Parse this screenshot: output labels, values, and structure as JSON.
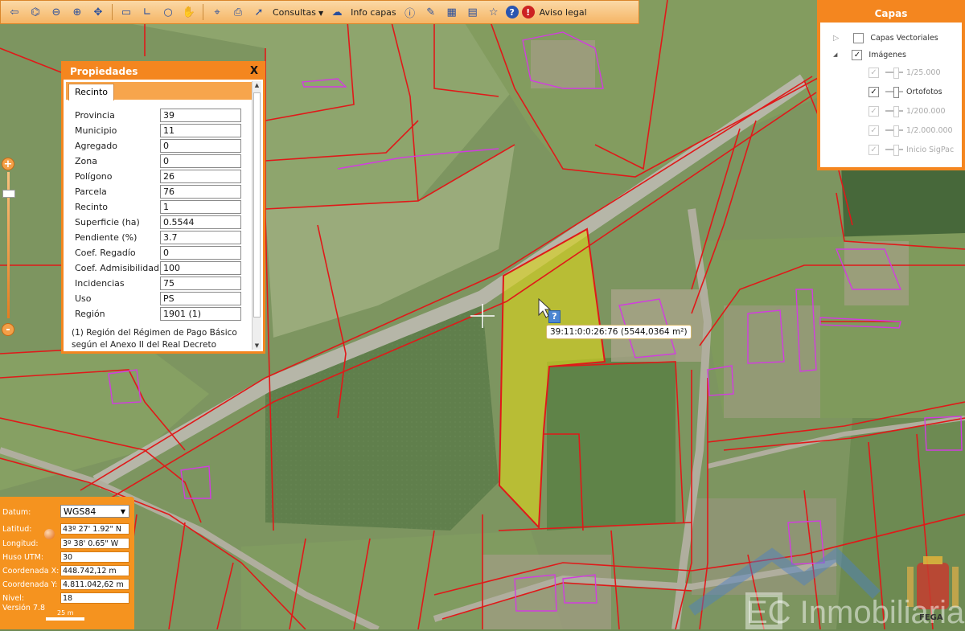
{
  "toolbar": {
    "consultas_label": "Consultas",
    "info_capas_label": "Info capas",
    "aviso_legal_label": "Aviso legal"
  },
  "properties": {
    "title": "Propiedades",
    "close_label": "X",
    "tab_label": "Recinto",
    "rows": [
      {
        "label": "Provincia",
        "value": "39"
      },
      {
        "label": "Municipio",
        "value": "11"
      },
      {
        "label": "Agregado",
        "value": "0"
      },
      {
        "label": "Zona",
        "value": "0"
      },
      {
        "label": "Polígono",
        "value": "26"
      },
      {
        "label": "Parcela",
        "value": "76"
      },
      {
        "label": "Recinto",
        "value": "1"
      },
      {
        "label": "Superficie (ha)",
        "value": "0.5544"
      },
      {
        "label": "Pendiente (%)",
        "value": "3.7"
      },
      {
        "label": "Coef. Regadío",
        "value": "0"
      },
      {
        "label": "Coef. Admisibilidad",
        "value": "100"
      },
      {
        "label": "Incidencias",
        "value": "75"
      },
      {
        "label": "Uso",
        "value": "PS"
      },
      {
        "label": "Región",
        "value": "1901 (1)"
      }
    ],
    "note": "(1) Región del Régimen de Pago Básico según el Anexo II del Real Decreto"
  },
  "layers": {
    "title": "Capas",
    "items": [
      {
        "label": "Capas Vectoriales",
        "checked": false,
        "enabled": true
      },
      {
        "label": "Imágenes",
        "checked": true,
        "enabled": true
      },
      {
        "label": "1/25.000",
        "checked": true,
        "enabled": false
      },
      {
        "label": "Ortofotos",
        "checked": true,
        "enabled": true
      },
      {
        "label": "1/200.000",
        "checked": true,
        "enabled": false
      },
      {
        "label": "1/2.000.000",
        "checked": true,
        "enabled": false
      },
      {
        "label": "Inicio SigPac",
        "checked": true,
        "enabled": false
      }
    ]
  },
  "zoom": {
    "plus": "+",
    "minus": "-"
  },
  "coords": {
    "datum_label": "Datum:",
    "datum_value": "WGS84",
    "rows": [
      {
        "label": "Latitud:",
        "value": "43º 27' 1.92\" N"
      },
      {
        "label": "Longitud:",
        "value": "3º 38' 0.65\" W"
      },
      {
        "label": "Huso UTM:",
        "value": "30"
      },
      {
        "label": "Coordenada X:",
        "value": "448.742,12 m"
      },
      {
        "label": "Coordenada Y:",
        "value": "4.811.042,62 m"
      },
      {
        "label": "Nivel:",
        "value": "18"
      }
    ],
    "version": "Versión 7.8",
    "scale": "25 m"
  },
  "map": {
    "tooltip": "39:11:0:0:26:76 (5544,0364 m²)",
    "help_badge": "?",
    "parcel_fill": "#d9d31e",
    "boundary_color": "#e01919",
    "alt_boundary_color": "#d23ce0"
  },
  "watermark": {
    "brand": "EC Inmobiliaria",
    "fega": "FEGA"
  },
  "colors": {
    "accent": "#f4861f"
  }
}
